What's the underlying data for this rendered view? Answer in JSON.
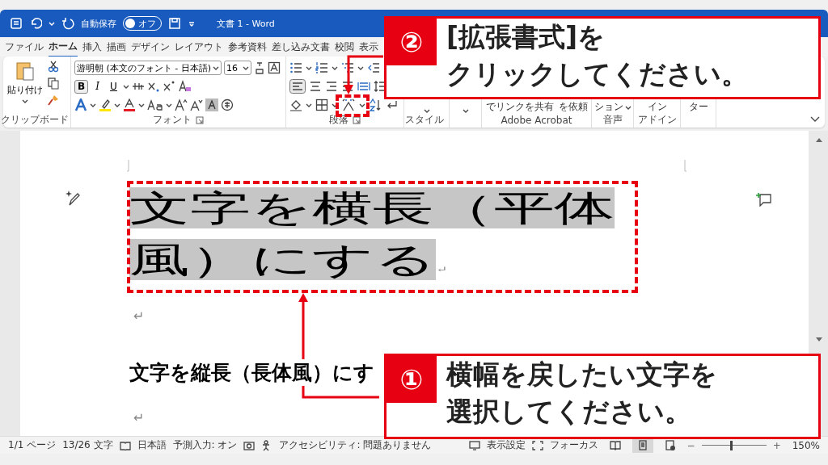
{
  "title_bar": {
    "autosave_label": "自動保存",
    "autosave": {
      "label": "オフ",
      "on": false
    },
    "title": "文書 1 - Word"
  },
  "tabs": [
    {
      "label": "ファイル",
      "selected": false
    },
    {
      "label": "ホーム",
      "selected": true
    },
    {
      "label": "挿入",
      "selected": false
    },
    {
      "label": "描画",
      "selected": false
    },
    {
      "label": "デザイン",
      "selected": false
    },
    {
      "label": "レイアウト",
      "selected": false
    },
    {
      "label": "参考資料",
      "selected": false
    },
    {
      "label": "差し込み文書",
      "selected": false
    },
    {
      "label": "校閲",
      "selected": false
    },
    {
      "label": "表示",
      "selected": false
    }
  ],
  "ribbon": {
    "paste_label": "貼り付け",
    "font_name": "游明朝 (本文のフォント - 日本語)",
    "font_size": "16",
    "bold": "B",
    "italic": "I",
    "underline": "U",
    "group_labels": [
      "クリップボード",
      "フォント",
      "段落",
      "スタイル",
      "Adobe Acrobat",
      "音声",
      "アドイン"
    ],
    "partial_labels": [
      "でリンクを共有",
      "を依頼",
      "ション",
      "イン",
      "ター"
    ]
  },
  "document": {
    "title_text": "文字を横長（平体風）にする",
    "title_selected": true,
    "return_mark": "↵",
    "second_text": "文字を縦長（長体風）にす"
  },
  "status_bar": {
    "left": [
      "1/1 ページ",
      "13/26 文字",
      "日本語",
      "予測入力: オン",
      "アクセシビリティ: 問題ありません"
    ],
    "view_settings": "表示設定",
    "focus": "フォーカス",
    "views": [
      {
        "selected": false
      },
      {
        "selected": true
      },
      {
        "selected": false
      }
    ],
    "zoom_minus": "−",
    "zoom_plus": "+",
    "zoom": {
      "level": 0.45
    },
    "zoom_text": "150%"
  },
  "callouts": [
    {
      "number": "②",
      "lines": [
        "[拡張書式]を",
        "クリックしてください。"
      ]
    },
    {
      "number": "①",
      "lines": [
        "横幅を戻したい文字を",
        "選択してください。"
      ]
    }
  ]
}
